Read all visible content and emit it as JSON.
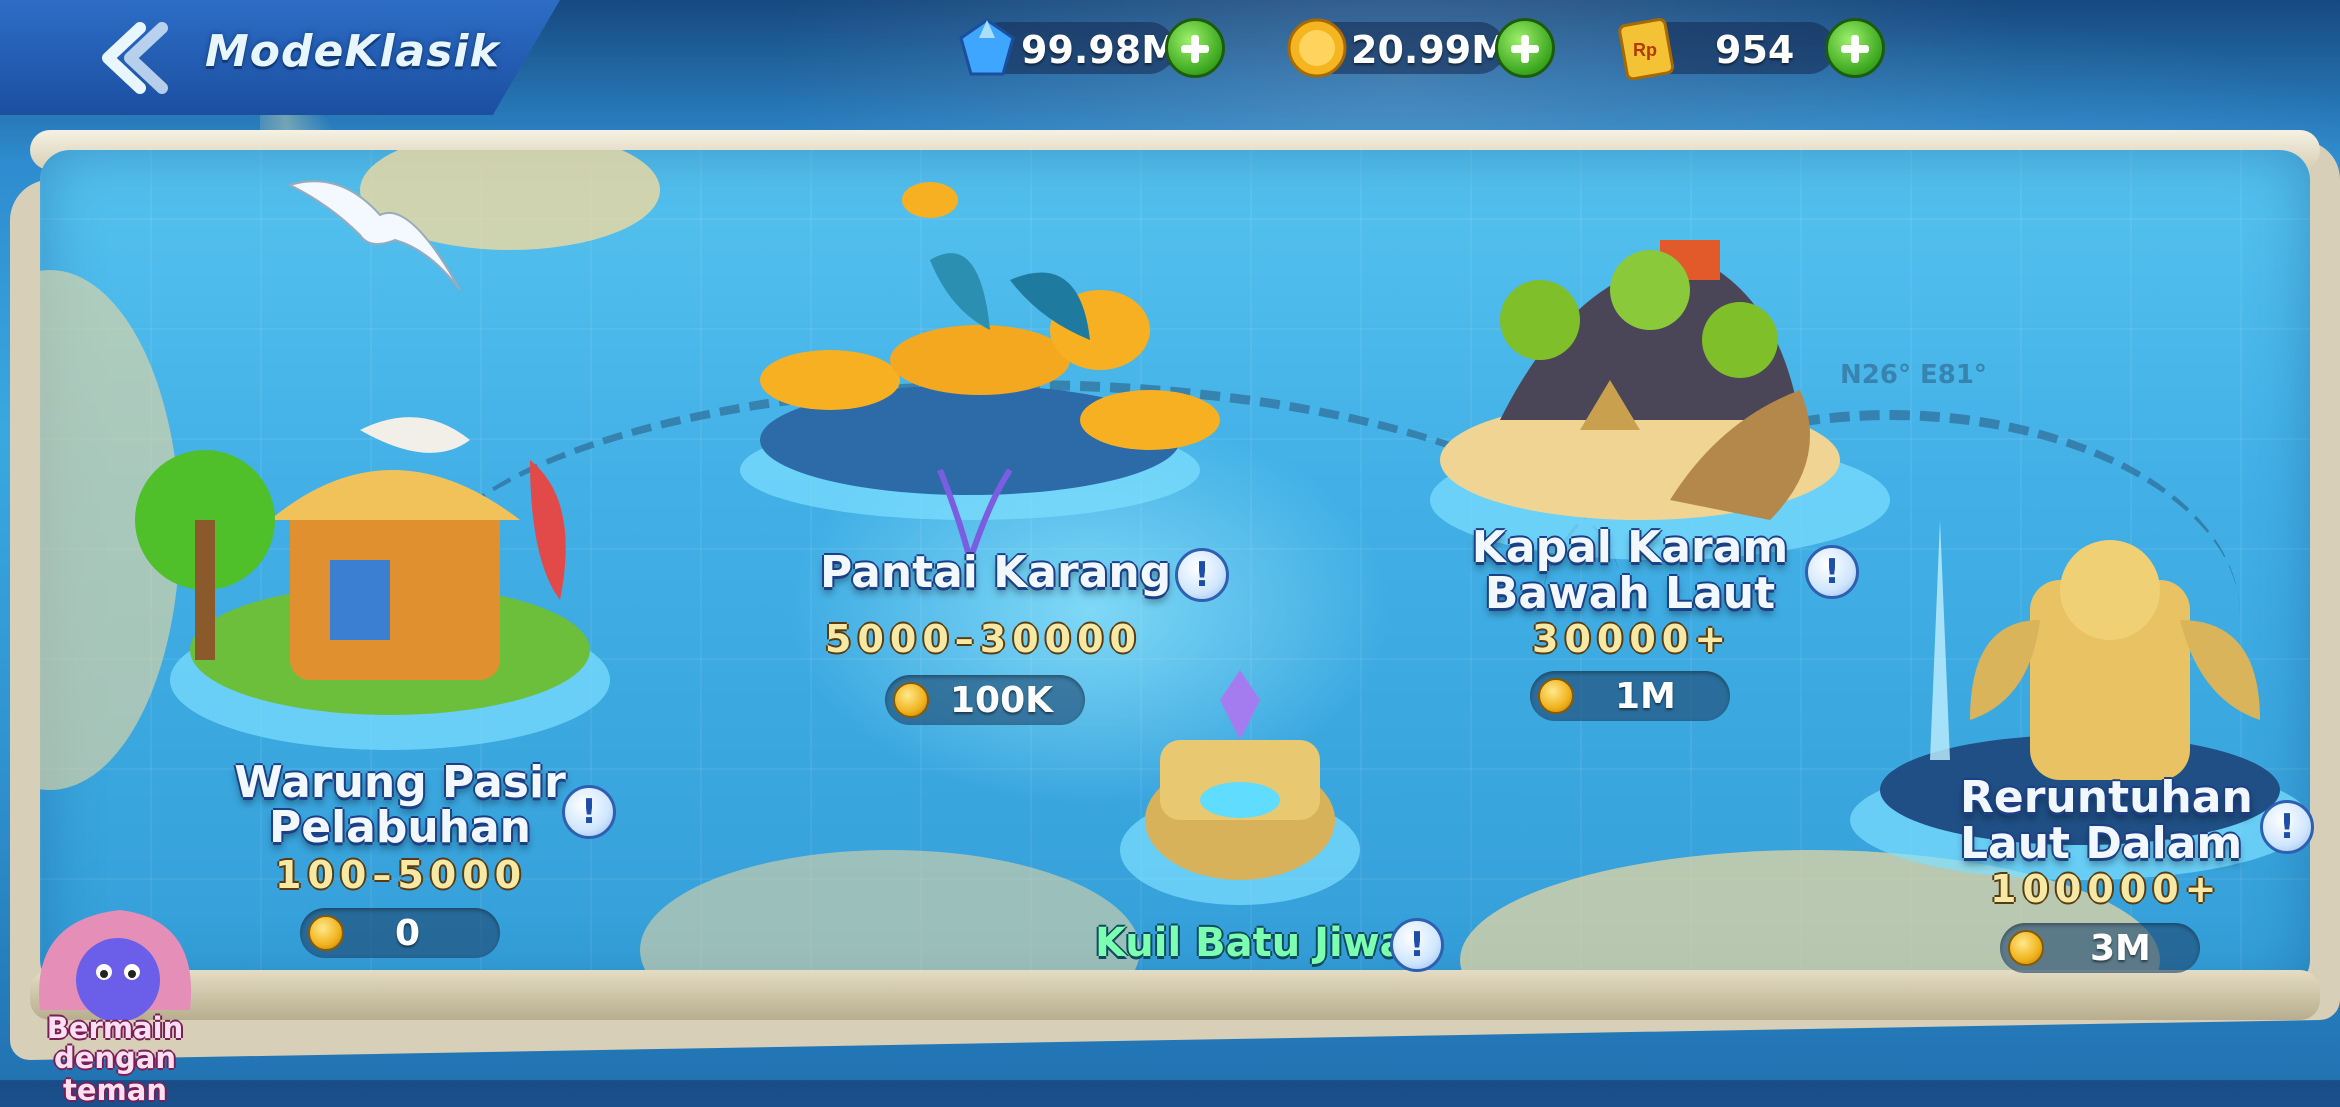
{
  "header": {
    "mode_title": "ModeKlasik",
    "currencies": [
      {
        "name": "gem",
        "value": "99.98M",
        "action": "add"
      },
      {
        "name": "gold-coin",
        "value": "20.99M",
        "action": "add"
      },
      {
        "name": "rp-ticket",
        "value": "954",
        "action": "exchange"
      }
    ]
  },
  "map": {
    "coords_label": "N26° E81°"
  },
  "rooms": [
    {
      "name_line1": "Warung Pasir",
      "name_line2": "Pelabuhan",
      "range": "100–5000",
      "min_bet": "0"
    },
    {
      "name_line1": "Pantai Karang",
      "name_line2": "",
      "range": "5000–30000",
      "min_bet": "100K"
    },
    {
      "name_line1": "Kapal Karam",
      "name_line2": "Bawah Laut",
      "range": "30000+",
      "min_bet": "1M"
    },
    {
      "name_line1": "Kuil Batu Jiwa",
      "name_line2": "",
      "range": "",
      "min_bet": ""
    },
    {
      "name_line1": "Reruntuhan",
      "name_line2": "Laut Dalam",
      "range": "100000+",
      "min_bet": "3M"
    }
  ],
  "play_with_friends": {
    "line1": "Bermain",
    "line2": "dengan teman"
  },
  "icons": {
    "back": "chevron-left-icon",
    "info": "info-icon",
    "coin": "coin-icon"
  },
  "colors": {
    "header_blue": "#1b4fa0",
    "ocean": "#42b0e6",
    "add_green": "#3aa61e",
    "range_gold": "#f6e9a6"
  }
}
